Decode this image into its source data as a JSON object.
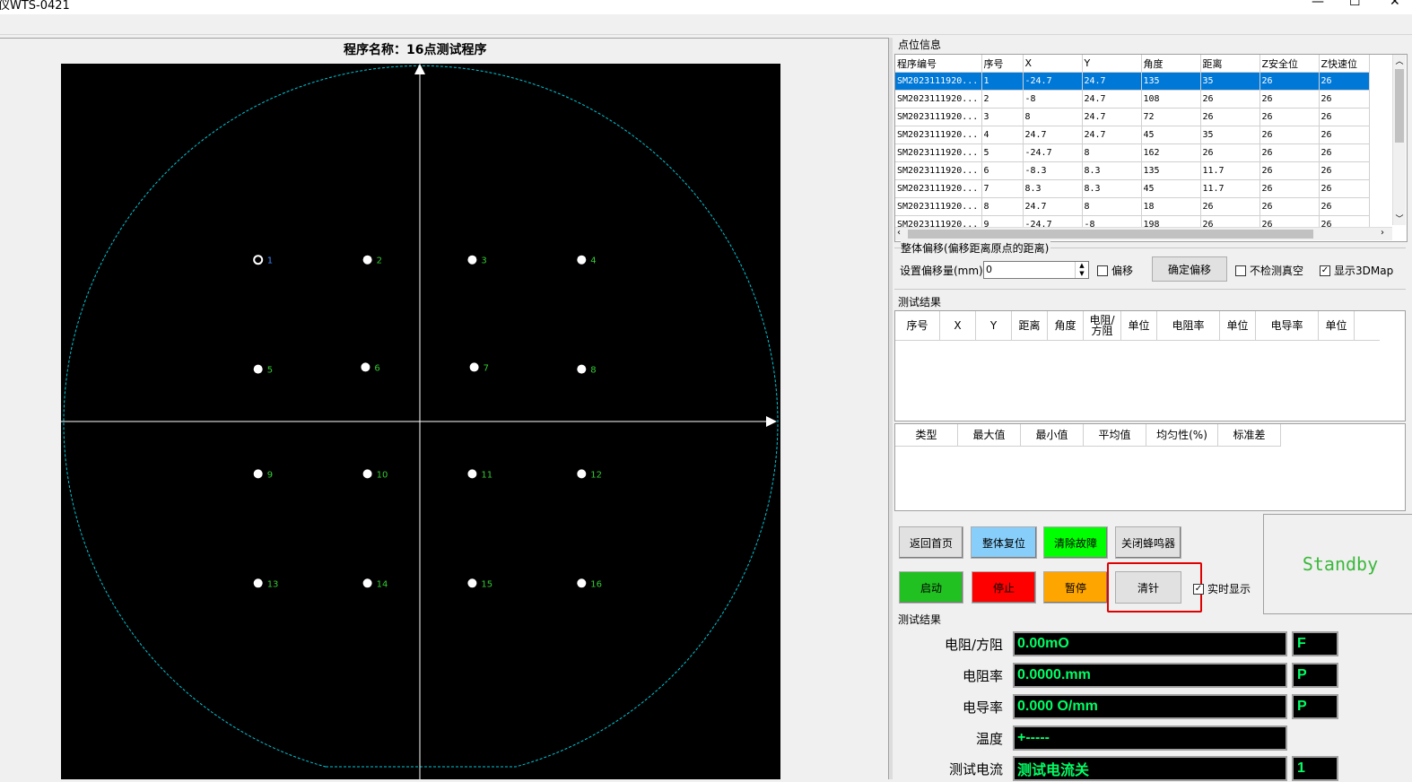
{
  "window": {
    "title": "仪WTS-0421",
    "minimize": "—",
    "maximize": "☐",
    "close": "✕"
  },
  "program": {
    "title": "程序名称：16点测试程序"
  },
  "points": [
    {
      "n": "1",
      "x": -24.7,
      "y": 24.7,
      "hollow": true
    },
    {
      "n": "2",
      "x": -8,
      "y": 24.7
    },
    {
      "n": "3",
      "x": 8,
      "y": 24.7
    },
    {
      "n": "4",
      "x": 24.7,
      "y": 24.7
    },
    {
      "n": "5",
      "x": -24.7,
      "y": 8
    },
    {
      "n": "6",
      "x": -8.3,
      "y": 8.3
    },
    {
      "n": "7",
      "x": 8.3,
      "y": 8.3
    },
    {
      "n": "8",
      "x": 24.7,
      "y": 8
    },
    {
      "n": "9",
      "x": -24.7,
      "y": -8
    },
    {
      "n": "10",
      "x": -8,
      "y": -8
    },
    {
      "n": "11",
      "x": 8,
      "y": -8
    },
    {
      "n": "12",
      "x": 24.7,
      "y": -8
    },
    {
      "n": "13",
      "x": -24.7,
      "y": -24.7
    },
    {
      "n": "14",
      "x": -8,
      "y": -24.7
    },
    {
      "n": "15",
      "x": 8,
      "y": -24.7
    },
    {
      "n": "16",
      "x": 24.7,
      "y": -24.7
    }
  ],
  "point_info": {
    "label": "点位信息",
    "columns": [
      "程序编号",
      "序号",
      "X",
      "Y",
      "角度",
      "距离",
      "Z安全位",
      "Z快速位"
    ],
    "rows": [
      [
        "SM2023111920...",
        "1",
        "-24.7",
        "24.7",
        "135",
        "35",
        "26",
        "26"
      ],
      [
        "SM2023111920...",
        "2",
        "-8",
        "24.7",
        "108",
        "26",
        "26",
        "26"
      ],
      [
        "SM2023111920...",
        "3",
        "8",
        "24.7",
        "72",
        "26",
        "26",
        "26"
      ],
      [
        "SM2023111920...",
        "4",
        "24.7",
        "24.7",
        "45",
        "35",
        "26",
        "26"
      ],
      [
        "SM2023111920...",
        "5",
        "-24.7",
        "8",
        "162",
        "26",
        "26",
        "26"
      ],
      [
        "SM2023111920...",
        "6",
        "-8.3",
        "8.3",
        "135",
        "11.7",
        "26",
        "26"
      ],
      [
        "SM2023111920...",
        "7",
        "8.3",
        "8.3",
        "45",
        "11.7",
        "26",
        "26"
      ],
      [
        "SM2023111920...",
        "8",
        "24.7",
        "8",
        "18",
        "26",
        "26",
        "26"
      ],
      [
        "SM2023111920...",
        "9",
        "-24.7",
        "-8",
        "198",
        "26",
        "26",
        "26"
      ]
    ]
  },
  "offset": {
    "group_label": "整体偏移(偏移距离原点的距离)",
    "set_label": "设置偏移量(mm)",
    "value": "0",
    "offset_check": "偏移",
    "confirm_button": "确定偏移",
    "no_vacuum_check": "不检测真空",
    "show_3d_check": "显示3DMap"
  },
  "test_results": {
    "label": "测试结果",
    "columns": [
      "序号",
      "X",
      "Y",
      "距离",
      "角度",
      "电阻/\n方阻",
      "单位",
      "电阻率",
      "单位",
      "电导率",
      "单位"
    ],
    "stats_columns": [
      "类型",
      "最大值",
      "最小值",
      "平均值",
      "均匀性(%)",
      "标准差"
    ]
  },
  "buttons": {
    "home": "返回首页",
    "reset": "整体复位",
    "clear_fault": "清除故障",
    "buzzer_off": "关闭蜂鸣器",
    "start": "启动",
    "stop": "停止",
    "pause": "暂停",
    "clean_needle": "清针",
    "realtime_check": "实时显示"
  },
  "status": {
    "text": "Standby"
  },
  "readout": {
    "label": "测试结果",
    "rows": [
      {
        "label": "电阻/方阻",
        "value": "0.00mO",
        "unit": "F"
      },
      {
        "label": "电阻率",
        "value": "0.0000.mm",
        "unit": "P"
      },
      {
        "label": "电导率",
        "value": "0.000 O/mm",
        "unit": "P"
      },
      {
        "label": "温度",
        "value": "+-----"
      },
      {
        "label": "测试电流",
        "value": "测试电流关",
        "unit": "1"
      }
    ]
  },
  "colors": {
    "selected_row": "#0078d7",
    "start_green": "#22c122",
    "stop_red": "#ff0000",
    "pause_orange": "#ffa500",
    "reset_blue": "#87cefa",
    "clear_fault_green": "#00ff00",
    "point_label_green": "#33cc33",
    "point_label_blue": "#3a8cff",
    "wafer_outline": "#00c8d8"
  }
}
